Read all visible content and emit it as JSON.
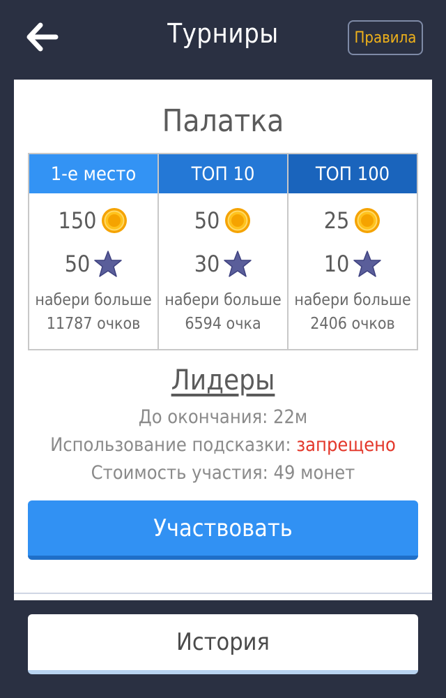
{
  "header": {
    "title": "Турниры",
    "rules_label": "Правила"
  },
  "tournament": {
    "name": "Палатка",
    "tiers": [
      {
        "label": "1-е место",
        "color": "#3393f4",
        "coins": "150",
        "stars": "50",
        "condition_line1": "набери больше",
        "condition_line2": "11787 очков"
      },
      {
        "label": "ТОП 10",
        "color": "#2478d6",
        "coins": "50",
        "stars": "30",
        "condition_line1": "набери больше",
        "condition_line2": "6594 очка"
      },
      {
        "label": "ТОП 100",
        "color": "#1a64bc",
        "coins": "25",
        "stars": "10",
        "condition_line1": "набери больше",
        "condition_line2": "2406 очков"
      }
    ]
  },
  "leaders": {
    "title": "Лидеры",
    "ends_in": "До окончания: 22м",
    "hint_usage_label": "Использование подсказки:",
    "hint_usage_value": "запрещено",
    "cost": "Стоимость участия: 49 монет"
  },
  "buttons": {
    "join": "Участвовать",
    "history": "История"
  },
  "icons": {
    "back": "arrow-left-icon",
    "coin": "coin-icon",
    "star": "star-icon"
  },
  "colors": {
    "background": "#2a3042",
    "accent_button": "#3191f3",
    "rules_text": "#f0b21a",
    "forbidden": "#e3372a"
  }
}
